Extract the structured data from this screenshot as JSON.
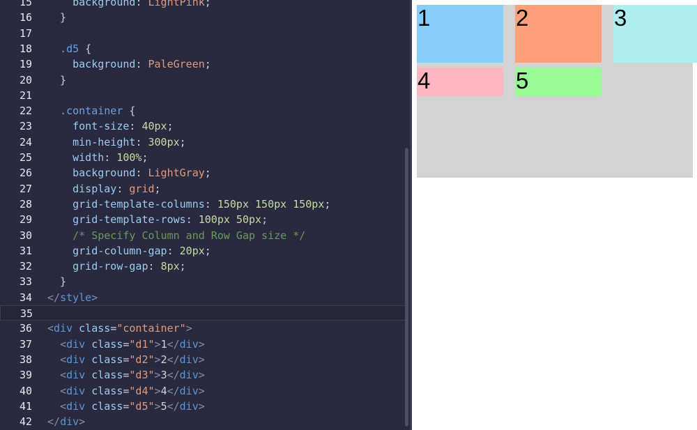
{
  "editor": {
    "lines": [
      {
        "num": "15",
        "tokens": [
          {
            "t": "    "
          },
          {
            "t": "background",
            "c": "prop"
          },
          {
            "t": ": "
          },
          {
            "t": "LightPink",
            "c": "value"
          },
          {
            "t": ";"
          }
        ]
      },
      {
        "num": "16",
        "tokens": [
          {
            "t": "  }"
          }
        ]
      },
      {
        "num": "17",
        "tokens": []
      },
      {
        "num": "18",
        "tokens": [
          {
            "t": "  "
          },
          {
            "t": ".d5",
            "c": "selector"
          },
          {
            "t": " {"
          }
        ]
      },
      {
        "num": "19",
        "tokens": [
          {
            "t": "    "
          },
          {
            "t": "background",
            "c": "prop"
          },
          {
            "t": ": "
          },
          {
            "t": "PaleGreen",
            "c": "value"
          },
          {
            "t": ";"
          }
        ]
      },
      {
        "num": "20",
        "tokens": [
          {
            "t": "  }"
          }
        ]
      },
      {
        "num": "21",
        "tokens": []
      },
      {
        "num": "22",
        "tokens": [
          {
            "t": "  "
          },
          {
            "t": ".container",
            "c": "selector"
          },
          {
            "t": " {"
          }
        ]
      },
      {
        "num": "23",
        "tokens": [
          {
            "t": "    "
          },
          {
            "t": "font-size",
            "c": "prop"
          },
          {
            "t": ": "
          },
          {
            "t": "40px",
            "c": "num"
          },
          {
            "t": ";"
          }
        ]
      },
      {
        "num": "24",
        "tokens": [
          {
            "t": "    "
          },
          {
            "t": "min-height",
            "c": "prop"
          },
          {
            "t": ": "
          },
          {
            "t": "300px",
            "c": "num"
          },
          {
            "t": ";"
          }
        ]
      },
      {
        "num": "25",
        "tokens": [
          {
            "t": "    "
          },
          {
            "t": "width",
            "c": "prop"
          },
          {
            "t": ": "
          },
          {
            "t": "100%",
            "c": "num"
          },
          {
            "t": ";"
          }
        ]
      },
      {
        "num": "26",
        "tokens": [
          {
            "t": "    "
          },
          {
            "t": "background",
            "c": "prop"
          },
          {
            "t": ": "
          },
          {
            "t": "LightGray",
            "c": "value"
          },
          {
            "t": ";"
          }
        ]
      },
      {
        "num": "27",
        "tokens": [
          {
            "t": "    "
          },
          {
            "t": "display",
            "c": "prop"
          },
          {
            "t": ": "
          },
          {
            "t": "grid",
            "c": "value"
          },
          {
            "t": ";"
          }
        ]
      },
      {
        "num": "28",
        "tokens": [
          {
            "t": "    "
          },
          {
            "t": "grid-template-columns",
            "c": "prop"
          },
          {
            "t": ": "
          },
          {
            "t": "150px 150px 150px",
            "c": "num"
          },
          {
            "t": ";"
          }
        ]
      },
      {
        "num": "29",
        "tokens": [
          {
            "t": "    "
          },
          {
            "t": "grid-template-rows",
            "c": "prop"
          },
          {
            "t": ": "
          },
          {
            "t": "100px 50px",
            "c": "num"
          },
          {
            "t": ";"
          }
        ]
      },
      {
        "num": "30",
        "tokens": [
          {
            "t": "    "
          },
          {
            "t": "/* Specify Column and Row Gap size */",
            "c": "comment"
          }
        ]
      },
      {
        "num": "31",
        "tokens": [
          {
            "t": "    "
          },
          {
            "t": "grid-column-gap",
            "c": "prop"
          },
          {
            "t": ": "
          },
          {
            "t": "20px",
            "c": "num"
          },
          {
            "t": ";"
          }
        ]
      },
      {
        "num": "32",
        "tokens": [
          {
            "t": "    "
          },
          {
            "t": "grid-row-gap",
            "c": "prop"
          },
          {
            "t": ": "
          },
          {
            "t": "8px",
            "c": "num"
          },
          {
            "t": ";"
          }
        ]
      },
      {
        "num": "33",
        "tokens": [
          {
            "t": "  }"
          }
        ]
      },
      {
        "num": "34",
        "tokens": [
          {
            "t": "</",
            "c": "bracket"
          },
          {
            "t": "style",
            "c": "tag"
          },
          {
            "t": ">",
            "c": "bracket"
          }
        ]
      },
      {
        "num": "35",
        "tokens": [],
        "current": true
      },
      {
        "num": "36",
        "tokens": [
          {
            "t": "<",
            "c": "bracket"
          },
          {
            "t": "div",
            "c": "tag"
          },
          {
            "t": " "
          },
          {
            "t": "class",
            "c": "attr"
          },
          {
            "t": "="
          },
          {
            "t": "\"container\"",
            "c": "string"
          },
          {
            "t": ">",
            "c": "bracket"
          }
        ]
      },
      {
        "num": "37",
        "tokens": [
          {
            "t": "  "
          },
          {
            "t": "<",
            "c": "bracket"
          },
          {
            "t": "div",
            "c": "tag"
          },
          {
            "t": " "
          },
          {
            "t": "class",
            "c": "attr"
          },
          {
            "t": "="
          },
          {
            "t": "\"d1\"",
            "c": "string"
          },
          {
            "t": ">",
            "c": "bracket"
          },
          {
            "t": "1",
            "c": "text"
          },
          {
            "t": "</",
            "c": "bracket"
          },
          {
            "t": "div",
            "c": "tag"
          },
          {
            "t": ">",
            "c": "bracket"
          }
        ]
      },
      {
        "num": "38",
        "tokens": [
          {
            "t": "  "
          },
          {
            "t": "<",
            "c": "bracket"
          },
          {
            "t": "div",
            "c": "tag"
          },
          {
            "t": " "
          },
          {
            "t": "class",
            "c": "attr"
          },
          {
            "t": "="
          },
          {
            "t": "\"d2\"",
            "c": "string"
          },
          {
            "t": ">",
            "c": "bracket"
          },
          {
            "t": "2",
            "c": "text"
          },
          {
            "t": "</",
            "c": "bracket"
          },
          {
            "t": "div",
            "c": "tag"
          },
          {
            "t": ">",
            "c": "bracket"
          }
        ]
      },
      {
        "num": "39",
        "tokens": [
          {
            "t": "  "
          },
          {
            "t": "<",
            "c": "bracket"
          },
          {
            "t": "div",
            "c": "tag"
          },
          {
            "t": " "
          },
          {
            "t": "class",
            "c": "attr"
          },
          {
            "t": "="
          },
          {
            "t": "\"d3\"",
            "c": "string"
          },
          {
            "t": ">",
            "c": "bracket"
          },
          {
            "t": "3",
            "c": "text"
          },
          {
            "t": "</",
            "c": "bracket"
          },
          {
            "t": "div",
            "c": "tag"
          },
          {
            "t": ">",
            "c": "bracket"
          }
        ]
      },
      {
        "num": "40",
        "tokens": [
          {
            "t": "  "
          },
          {
            "t": "<",
            "c": "bracket"
          },
          {
            "t": "div",
            "c": "tag"
          },
          {
            "t": " "
          },
          {
            "t": "class",
            "c": "attr"
          },
          {
            "t": "="
          },
          {
            "t": "\"d4\"",
            "c": "string"
          },
          {
            "t": ">",
            "c": "bracket"
          },
          {
            "t": "4",
            "c": "text"
          },
          {
            "t": "</",
            "c": "bracket"
          },
          {
            "t": "div",
            "c": "tag"
          },
          {
            "t": ">",
            "c": "bracket"
          }
        ]
      },
      {
        "num": "41",
        "tokens": [
          {
            "t": "  "
          },
          {
            "t": "<",
            "c": "bracket"
          },
          {
            "t": "div",
            "c": "tag"
          },
          {
            "t": " "
          },
          {
            "t": "class",
            "c": "attr"
          },
          {
            "t": "="
          },
          {
            "t": "\"d5\"",
            "c": "string"
          },
          {
            "t": ">",
            "c": "bracket"
          },
          {
            "t": "5",
            "c": "text"
          },
          {
            "t": "</",
            "c": "bracket"
          },
          {
            "t": "div",
            "c": "tag"
          },
          {
            "t": ">",
            "c": "bracket"
          }
        ]
      },
      {
        "num": "42",
        "tokens": [
          {
            "t": "</",
            "c": "bracket"
          },
          {
            "t": "div",
            "c": "tag"
          },
          {
            "t": ">",
            "c": "bracket"
          }
        ]
      }
    ]
  },
  "preview": {
    "cells": [
      {
        "label": "1",
        "color": "#87cefa"
      },
      {
        "label": "2",
        "color": "#ffa07a"
      },
      {
        "label": "3",
        "color": "#afeeee"
      },
      {
        "label": "4",
        "color": "#ffb6c1"
      },
      {
        "label": "5",
        "color": "#98fb98"
      }
    ]
  }
}
